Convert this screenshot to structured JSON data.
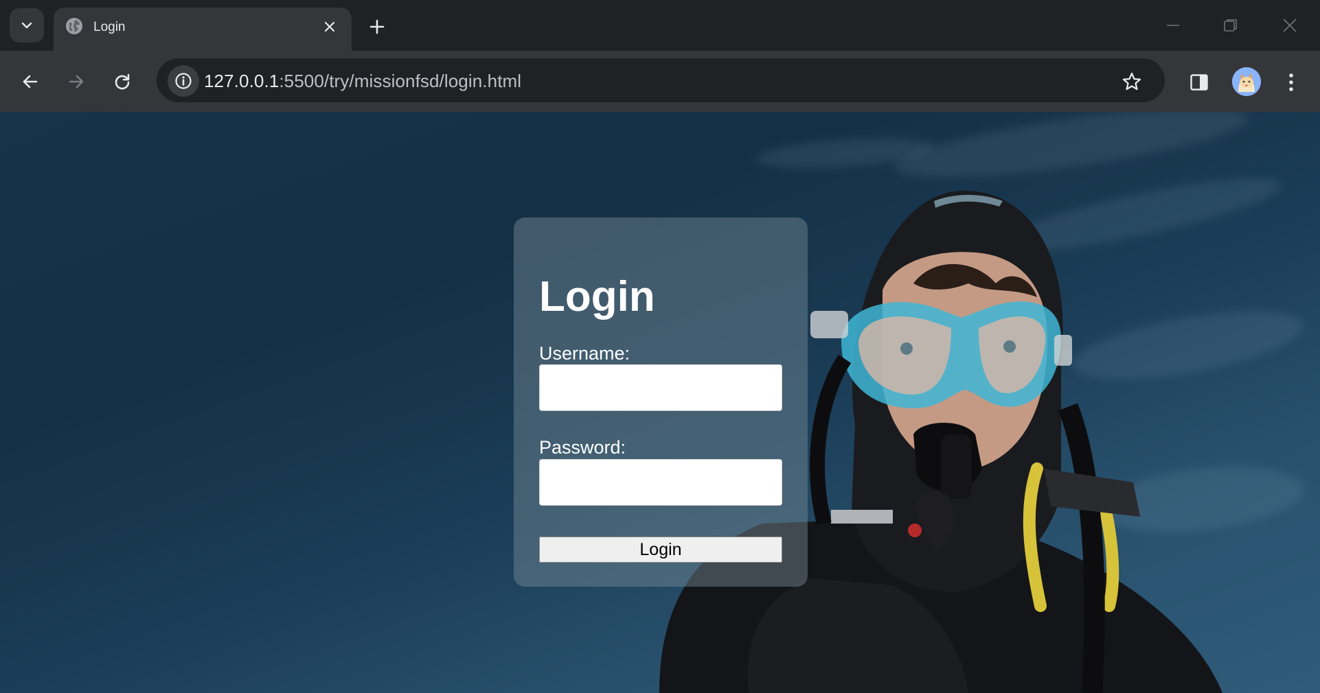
{
  "browser": {
    "tab": {
      "title": "Login",
      "favicon": "globe-icon"
    },
    "address_bar": {
      "host": "127.0.0.1",
      "path": ":5500/try/missionfsd/login.html"
    },
    "icons": {
      "tab_search": "chevron-down-icon",
      "new_tab": "plus-icon",
      "back": "arrow-left-icon",
      "forward": "arrow-right-icon",
      "reload": "reload-icon",
      "site_info": "info-icon",
      "bookmark": "star-icon",
      "side_panel": "side-panel-icon",
      "profile": "avatar",
      "menu": "kebab-menu-icon"
    }
  },
  "page": {
    "login": {
      "title": "Login",
      "username_label": "Username:",
      "username_value": "",
      "password_label": "Password:",
      "password_value": "",
      "button_label": "Login"
    }
  },
  "colors": {
    "chrome_dark": "#202124",
    "chrome_toolbar": "#35363a",
    "card_overlay": "rgba(120,140,150,0.45)",
    "mask_blue": "#3fb6d6"
  }
}
